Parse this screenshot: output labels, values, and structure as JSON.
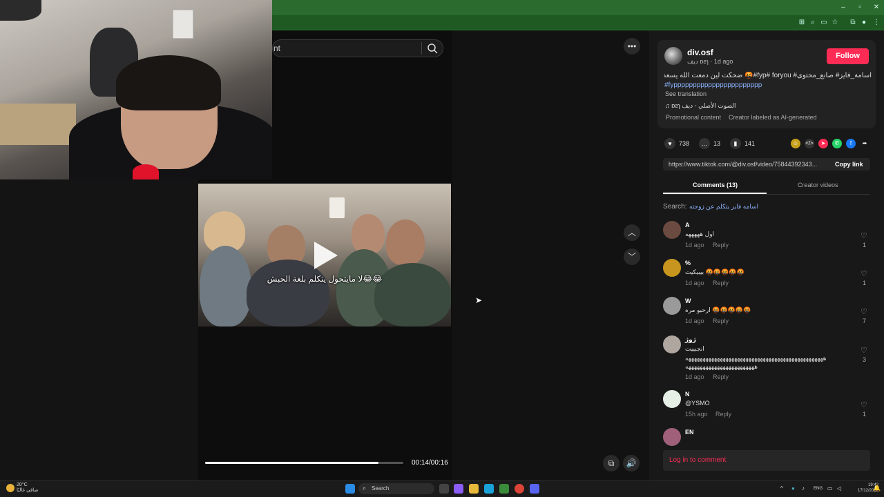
{
  "browser": {
    "window_controls": [
      "–",
      "▫",
      "✕"
    ]
  },
  "search": {
    "partial_placeholder": "nt"
  },
  "video": {
    "caption": "لا مايتحول يتكلم بلغة الحبش😂😂",
    "timecode": "00:14/00:16",
    "progress": 0.875
  },
  "author": {
    "name": "div.osf",
    "subtitle": "ديف ɒƨɿ · 1d ago",
    "follow_label": "Follow",
    "description_line1": "اسامة_فايز# صانع_محتوى# fyp# foryou#🤬 ضحكت لين دمعت الله يسعده",
    "description_line2": "#fyppppppppppppppppppppppp",
    "see_translation": "See translation",
    "sound": "♫ ɒƨɿ الصوت الأصلي - ديف",
    "chips": [
      "Promotional content",
      "Creator labeled as AI-generated"
    ]
  },
  "stats": {
    "likes": "738",
    "comments": "13",
    "saves": "141"
  },
  "share": {
    "url": "https://www.tiktok.com/@div.osf/video/75844392343...",
    "copy_label": "Copy link"
  },
  "tabs": {
    "comments_label": "Comments (13)",
    "creator_label": "Creator videos"
  },
  "search_suggestion": {
    "label": "Search:",
    "query": "اسامه فايز يتكلم عن زوجته"
  },
  "comments": [
    {
      "name": "A",
      "text": "اول هههههه",
      "time": "1d ago",
      "reply": "Reply",
      "likes": "1",
      "avatar_color": "#6b4a3f"
    },
    {
      "name": "%",
      "text": "بيبيكيت 🤬🤬🤬🤬🤬",
      "time": "1d ago",
      "reply": "Reply",
      "likes": "1",
      "avatar_color": "#c8961e"
    },
    {
      "name": "W",
      "text": "ارحبو مره 🤬🤬🤬🤬🤬",
      "time": "1d ago",
      "reply": "Reply",
      "likes": "7",
      "avatar_color": "#9a9a9a"
    },
    {
      "name": "ژوژ",
      "text": "انجبييت",
      "text2": "ههههههههههههههههههههههههههههههههههههههههههههههههه",
      "text3": "ههههههههههههههههههههههههه",
      "time": "1d ago",
      "reply": "Reply",
      "likes": "3",
      "avatar_color": "#b0a6a0"
    },
    {
      "name": "N",
      "text": "@YSMO",
      "time": "15h ago",
      "reply": "Reply",
      "likes": "1",
      "avatar_color": "#e6efe6"
    },
    {
      "name": "EN",
      "text": "",
      "time": "",
      "reply": "",
      "likes": "",
      "avatar_color": "#a0607a"
    }
  ],
  "login": {
    "label": "Log in to comment"
  },
  "taskbar": {
    "weather_temp": "20°C",
    "weather_desc": "صافي غالبًا",
    "search_label": "Search",
    "lang": "ENG",
    "time": "19:42",
    "date": "17/12/2025"
  }
}
